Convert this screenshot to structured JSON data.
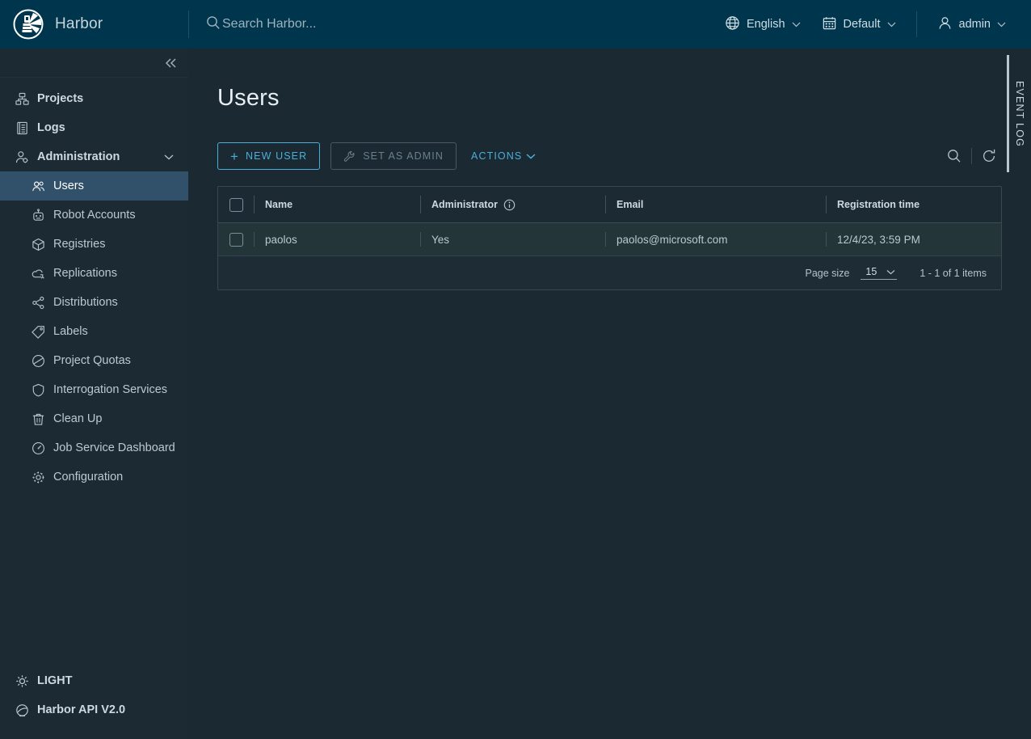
{
  "header": {
    "logo_icon": "harbor-lighthouse-logo",
    "brand": "Harbor",
    "search": {
      "icon": "search-icon",
      "placeholder": "Search Harbor..."
    },
    "language": {
      "icon": "globe-icon",
      "label": "English",
      "caret": "chevron-down-icon"
    },
    "project": {
      "icon": "calendar-icon",
      "label": "Default",
      "caret": "chevron-down-icon"
    },
    "user": {
      "icon": "user-icon",
      "label": "admin",
      "caret": "chevron-down-icon"
    }
  },
  "sidebar": {
    "collapse_icon": "double-chevron-left-icon",
    "items": [
      {
        "label": "Projects",
        "icon": "projects-icon",
        "level": "top"
      },
      {
        "label": "Logs",
        "icon": "logs-icon",
        "level": "top"
      },
      {
        "label": "Administration",
        "icon": "administration-icon",
        "level": "top",
        "expanded": true,
        "caret": "chevron-down-icon"
      },
      {
        "label": "Users",
        "icon": "users-icon",
        "level": "sub",
        "active": true
      },
      {
        "label": "Robot Accounts",
        "icon": "robot-icon",
        "level": "sub"
      },
      {
        "label": "Registries",
        "icon": "cube-icon",
        "level": "sub"
      },
      {
        "label": "Replications",
        "icon": "replication-cloud-icon",
        "level": "sub"
      },
      {
        "label": "Distributions",
        "icon": "share-nodes-icon",
        "level": "sub"
      },
      {
        "label": "Labels",
        "icon": "tag-icon",
        "level": "sub"
      },
      {
        "label": "Project Quotas",
        "icon": "pie-chart-icon",
        "level": "sub"
      },
      {
        "label": "Interrogation Services",
        "icon": "shield-icon",
        "level": "sub"
      },
      {
        "label": "Clean Up",
        "icon": "trash-icon",
        "level": "sub"
      },
      {
        "label": "Job Service Dashboard",
        "icon": "gauge-icon",
        "level": "sub"
      },
      {
        "label": "Configuration",
        "icon": "gear-icon",
        "level": "sub"
      }
    ],
    "bottom": [
      {
        "label": "LIGHT",
        "icon": "sun-icon"
      },
      {
        "label": "Harbor API V2.0",
        "icon": "api-swagger-icon"
      }
    ]
  },
  "main": {
    "title": "Users",
    "toolbar": {
      "new_user": {
        "label": "New User",
        "icon": "plus-icon"
      },
      "set_as_admin": {
        "label": "Set as Admin",
        "icon": "wrench-icon",
        "disabled": true
      },
      "actions": {
        "label": "Actions",
        "caret": "chevron-down-icon"
      },
      "search_icon": "search-icon",
      "refresh_icon": "refresh-icon"
    },
    "table": {
      "select_all_checkbox": "select-all-checkbox",
      "columns": [
        {
          "label": "Name"
        },
        {
          "label": "Administrator",
          "info_icon": "info-icon"
        },
        {
          "label": "Email"
        },
        {
          "label": "Registration time"
        }
      ],
      "rows": [
        {
          "name": "paolos",
          "administrator": "Yes",
          "email": "paolos@microsoft.com",
          "registration_time": "12/4/23, 3:59 PM"
        }
      ]
    },
    "footer": {
      "page_size_label": "Page size",
      "page_size_value": "15",
      "page_size_caret": "chevron-down-icon",
      "item_range": "1 - 1 of 1 items"
    }
  },
  "event_log": {
    "label": "EVENT LOG"
  },
  "colors": {
    "header_bg": "#00364d",
    "sidebar_bg": "#1b2a33",
    "main_bg": "#1b2a32",
    "accent": "#4aaed9",
    "active_nav": "#31506a",
    "row_bg": "#243539"
  }
}
